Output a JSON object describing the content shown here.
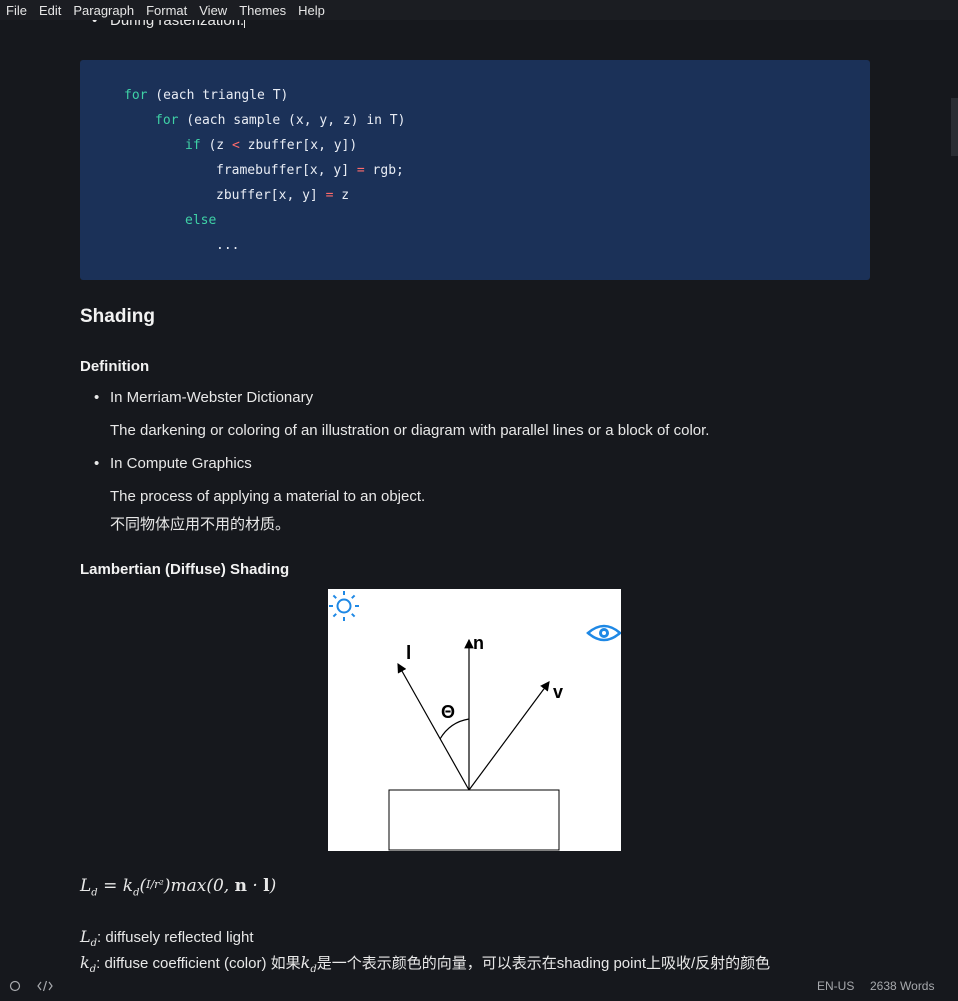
{
  "menu": [
    "File",
    "Edit",
    "Paragraph",
    "Format",
    "View",
    "Themes",
    "Help"
  ],
  "top_bullet": "During rasterization:",
  "code": {
    "lines": [
      {
        "kw": "for",
        "rest": " (each triangle T)"
      },
      {
        "kw": "for",
        "rest": " (each sample (x, y, z) in T)"
      },
      {
        "kw": "if",
        "pre": " (z ",
        "op": "<",
        "post": " zbuffer[x, y])"
      },
      {
        "pre": "framebuffer[x, y] ",
        "op": "=",
        "post": " rgb;"
      },
      {
        "pre": "zbuffer[x, y] ",
        "op": "=",
        "post": " z"
      },
      {
        "kw": "else",
        "rest": ""
      },
      {
        "pre": "...",
        "op": "",
        "post": ""
      }
    ]
  },
  "section": {
    "title": "Shading",
    "definition_heading": "Definition",
    "bullet1": "In Merriam-Webster Dictionary",
    "bullet1_text": "The darkening or coloring of an illustration or diagram with parallel lines or a block of color.",
    "bullet2": "In Compute Graphics",
    "bullet2_text": "The process of applying a material to an object.",
    "bullet2_cn": "不同物体应用不用的材质。",
    "lambert_heading": "Lambertian (Diffuse) Shading"
  },
  "figure": {
    "label_l": "l",
    "label_n": "n",
    "label_v": "v",
    "label_theta": "Θ",
    "sun_icon": "sun-icon",
    "eye_icon": "eye-icon",
    "sun_color": "#1e88e5",
    "eye_color": "#1e88e5"
  },
  "formula": {
    "main": "L_d = k_d (I / r^2) max(0, n · l)",
    "ld_sym": "L",
    "ld_sub": "d",
    "ld_text": ": diffusely reflected light",
    "kd_sym": "k",
    "kd_sub": "d",
    "kd_text_1": ": diffuse coefficient (color) 如果",
    "kd_text_2": "是一个表示颜色的向量，可以表示在shading point上吸收/反射的颜色"
  },
  "status": {
    "language": "EN-US",
    "words": "2638 Words"
  },
  "colors": {
    "background": "#16181d",
    "code_bg": "#1b3158",
    "keyword": "#3fd1a6",
    "operator": "#ff6b6b"
  }
}
